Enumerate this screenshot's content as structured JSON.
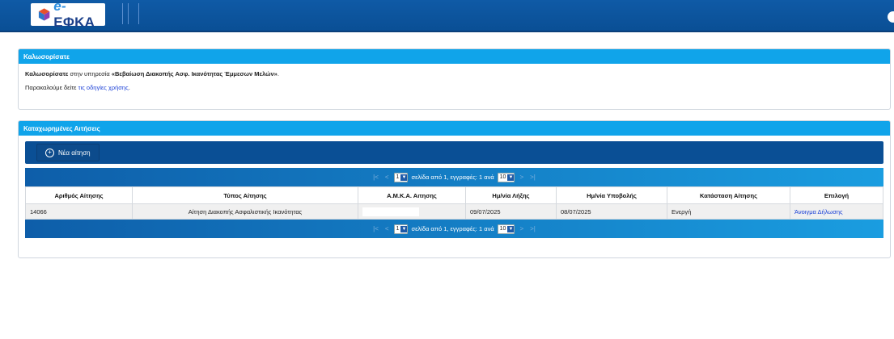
{
  "header": {
    "logo_text": "ΕΦΚΑ",
    "logo_prefix": "e-"
  },
  "welcome": {
    "title": "Καλωσορίσατε",
    "line1_intro": "Καλωσορίσατε",
    "line1_mid": " στην υπηρεσία ",
    "line1_service": "«Βεβαίωση Διακοπής Ασφ. Ικανότητας Έμμεσων Μελών»",
    "line1_end": ".",
    "line2_text": "Παρακαλούμε δείτε ",
    "line2_link": "τις οδηγίες χρήσης",
    "line2_end": "."
  },
  "applications": {
    "title": "Καταχωρημένες Αιτήσεις",
    "new_button": "Νέα αίτηση",
    "pager": {
      "page": "1",
      "text": "σελίδα από 1, εγγραφές: 1 ανά",
      "per_page": "10",
      "first": "|<",
      "prev": "<",
      "next": ">",
      "last": ">|"
    },
    "columns": [
      "Αριθμός Αίτησης",
      "Τύπος Αίτησης",
      "Α.Μ.Κ.Α. Αιτησης",
      "Ημ/νία Λήξης",
      "Ημ/νία Υποβολής",
      "Κατάσταση Αίτησης",
      "Επιλογή"
    ],
    "rows": [
      {
        "number": "14066",
        "type": "Αίτηση Διακοπής Ασφαλιστικής Ικανότητας",
        "amka": "",
        "expiry": "09/07/2025",
        "submitted": "08/07/2025",
        "status": "Ενεργή",
        "action": "Άνοιγμα Δήλωσης"
      }
    ]
  },
  "colors": {
    "header_bg": "#0a4f95",
    "panel_header": "#10a4ea",
    "link": "#1a3fd6"
  }
}
